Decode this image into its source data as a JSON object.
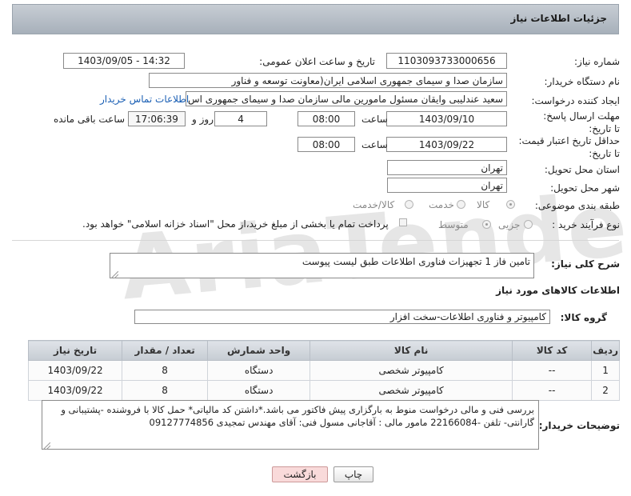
{
  "header": {
    "title": "جزئیات اطلاعات نیاز"
  },
  "watermark": {
    "text": "AriaTender.neT"
  },
  "fields": {
    "need_number_label": "شماره نیاز:",
    "need_number": "1103093733000656",
    "announce_label": "تاریخ و ساعت اعلان عمومی:",
    "announce_value": "1403/09/05 - 14:32",
    "buyer_org_label": "نام دستگاه خریدار:",
    "buyer_org": "سازمان صدا و سیمای جمهوری اسلامی ایران(معاونت توسعه و فناور",
    "requester_label": "ایجاد کننده درخواست:",
    "requester": "سعید عندلیبی وایقان مسئول مامورین مالی  سازمان صدا و سیمای جمهوری اس",
    "contact_link": "اطلاعات تماس خریدار",
    "deadline_label": "مهلت ارسال پاسخ: تا تاریخ:",
    "deadline_date": "1403/09/10",
    "time_label": "ساعت",
    "deadline_time": "08:00",
    "days_value": "4",
    "days_label": "روز و",
    "remaining_time": "17:06:39",
    "remaining_label": "ساعت باقی مانده",
    "validity_label": "حداقل تاریخ اعتبار قیمت: تا تاریخ:",
    "validity_date": "1403/09/22",
    "validity_time": "08:00",
    "province_label": "استان محل تحویل:",
    "province": "تهران",
    "city_label": "شهر محل تحویل:",
    "city": "تهران",
    "category_label": "طبقه بندی موضوعی:",
    "category_options": [
      "کالا",
      "خدمت",
      "کالا/خدمت"
    ],
    "process_label": "نوع فرآیند خرید :",
    "process_options": [
      "جزیی",
      "متوسط"
    ],
    "process_note": "پرداخت تمام یا بخشی از مبلغ خرید،از محل \"اسناد خزانه اسلامی\" خواهد بود.",
    "description_label": "شرح کلی نیاز:",
    "description": "تامین فاز 1 تجهیزات فناوری اطلاعات طبق لیست پیوست"
  },
  "goods": {
    "section_title": "اطلاعات کالاهای مورد نیاز",
    "group_label": "گروه کالا:",
    "group_value": "کامپیوتر و فناوری اطلاعات-سخت افزار",
    "columns": [
      "ردیف",
      "کد کالا",
      "نام کالا",
      "واحد شمارش",
      "تعداد / مقدار",
      "تاریخ نیاز"
    ],
    "rows": [
      [
        "1",
        "--",
        "کامپیوتر شخصی",
        "دستگاه",
        "8",
        "1403/09/22"
      ],
      [
        "2",
        "--",
        "کامپیوتر شخصی",
        "دستگاه",
        "8",
        "1403/09/22"
      ]
    ]
  },
  "buyer_notes": {
    "label": "توضیحات خریدار:",
    "text": "بررسی فنی و مالی درخواست منوط به بارگزاری پیش فاکتور می باشد.*داشتن کد مالیاتی*  حمل کالا با فروشنده -پشتیبانی و گارانتی- تلفن -22166084 مامور مالی : آقاجانی مسول فنی: آقای مهندس تمجیدی 09127774856"
  },
  "buttons": {
    "print": "چاپ",
    "back": "بازگشت"
  }
}
